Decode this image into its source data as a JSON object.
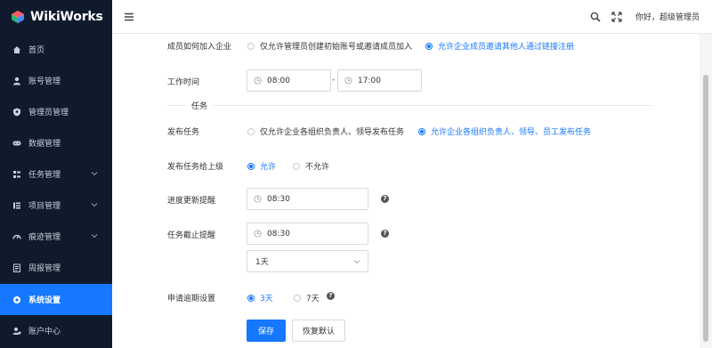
{
  "app": {
    "name": "WikiWorks"
  },
  "sidebar": {
    "items": [
      {
        "label": "首页",
        "icon": "home-icon",
        "expandable": false,
        "active": false
      },
      {
        "label": "账号管理",
        "icon": "user-icon",
        "expandable": false,
        "active": false
      },
      {
        "label": "管理员管理",
        "icon": "shield-icon",
        "expandable": false,
        "active": false
      },
      {
        "label": "数据管理",
        "icon": "gamepad-icon",
        "expandable": false,
        "active": false
      },
      {
        "label": "任务管理",
        "icon": "tasks-icon",
        "expandable": true,
        "active": false
      },
      {
        "label": "项目管理",
        "icon": "list-icon",
        "expandable": true,
        "active": false
      },
      {
        "label": "痕迹管理",
        "icon": "speedometer-icon",
        "expandable": true,
        "active": false
      },
      {
        "label": "周报管理",
        "icon": "report-icon",
        "expandable": false,
        "active": false
      },
      {
        "label": "系统设置",
        "icon": "gear-icon",
        "expandable": false,
        "active": true
      },
      {
        "label": "账户中心",
        "icon": "account-icon",
        "expandable": false,
        "active": false
      }
    ]
  },
  "header": {
    "greeting": "你好，超级管理员"
  },
  "form": {
    "join": {
      "label": "成员如何加入企业",
      "options": [
        {
          "label": "仅允许管理员创建初始账号或邀请成员加入",
          "checked": false
        },
        {
          "label": "允许企业成员邀请其他人通过链接注册",
          "checked": true
        }
      ]
    },
    "work_time": {
      "label": "工作时间",
      "start": "08:00",
      "separator": "-",
      "end": "17:00"
    },
    "task_section": {
      "title": "任务"
    },
    "publish": {
      "label": "发布任务",
      "options": [
        {
          "label": "仅允许企业各组织负责人、领导发布任务",
          "checked": false
        },
        {
          "label": "允许企业各组织负责人、领导、员工发布任务",
          "checked": true
        }
      ]
    },
    "publish_up": {
      "label": "发布任务给上级",
      "options": [
        {
          "label": "允许",
          "checked": true
        },
        {
          "label": "不允许",
          "checked": false
        }
      ]
    },
    "progress_reminder": {
      "label": "进度更新提醒",
      "value": "08:30"
    },
    "deadline_reminder": {
      "label": "任务截止提醒",
      "value": "08:30",
      "days": "1天"
    },
    "extension": {
      "label": "申请逾期设置",
      "options": [
        {
          "label": "3天",
          "checked": true
        },
        {
          "label": "7天",
          "checked": false
        }
      ]
    },
    "help_glyph": "?",
    "save_label": "保存",
    "reset_label": "恢复默认"
  },
  "colors": {
    "primary": "#1677ff",
    "sidebar_bg": "#0f1b2d"
  }
}
